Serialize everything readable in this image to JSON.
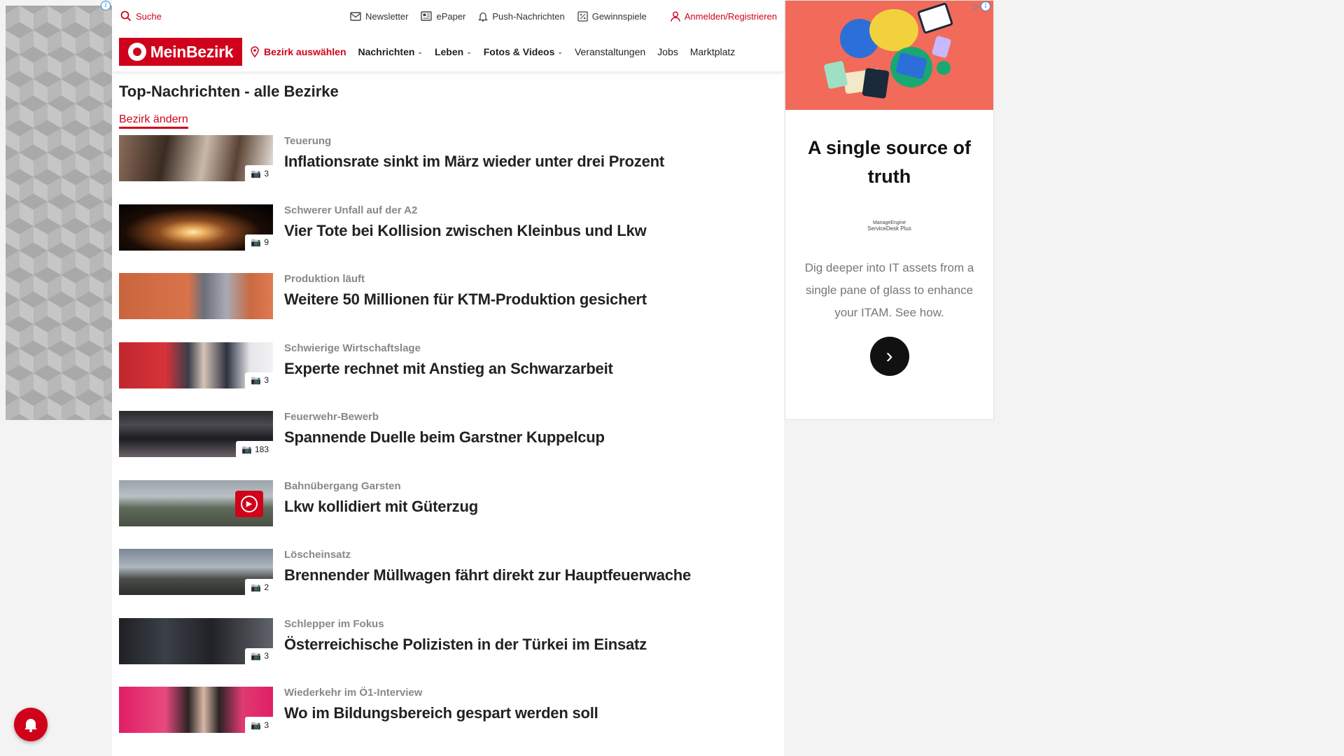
{
  "topbar": {
    "search": "Suche",
    "newsletter": "Newsletter",
    "epaper": "ePaper",
    "push": "Push-Nachrichten",
    "games": "Gewinnspiele",
    "login": "Anmelden/Registrieren"
  },
  "nav": {
    "logo": "MeinBezirk",
    "bezirk": "Bezirk auswählen",
    "items": [
      "Nachrichten",
      "Leben",
      "Fotos & Videos",
      "Veranstaltungen",
      "Jobs",
      "Marktplatz"
    ]
  },
  "page": {
    "title": "Top-Nachrichten - alle Bezirke",
    "change": "Bezirk ändern"
  },
  "articles": [
    {
      "kicker": "Teuerung",
      "headline": "Inflationsrate sinkt im März wieder unter drei Prozent",
      "badge": "3"
    },
    {
      "kicker": "Schwerer Unfall auf der A2",
      "headline": "Vier Tote bei Kollision zwischen Kleinbus und Lkw",
      "badge": "9"
    },
    {
      "kicker": "Produktion läuft",
      "headline": "Weitere 50 Millionen für KTM-Produktion gesichert",
      "badge": ""
    },
    {
      "kicker": "Schwierige Wirtschaftslage",
      "headline": "Experte rechnet mit Anstieg an Schwarzarbeit",
      "badge": "3"
    },
    {
      "kicker": "Feuerwehr-Bewerb",
      "headline": "Spannende Duelle beim Garstner Kuppelcup",
      "badge": "183"
    },
    {
      "kicker": "Bahnübergang Garsten",
      "headline": "Lkw kollidiert mit Güterzug",
      "badge": ""
    },
    {
      "kicker": "Löscheinsatz",
      "headline": "Brennender Müllwagen fährt direkt zur Hauptfeuerwache",
      "badge": "2"
    },
    {
      "kicker": "Schlepper im Fokus",
      "headline": "Österreichische Polizisten in der Türkei im Einsatz",
      "badge": "3"
    },
    {
      "kicker": "Wiederkehr im Ö1-Interview",
      "headline": "Wo im Bildungsbereich gespart werden soll",
      "badge": "3"
    }
  ],
  "ad": {
    "title": "A single source of truth",
    "brand_line1": "ManageEngine",
    "brand_line2": "ServiceDesk Plus",
    "description": "Dig deeper into IT assets from a single pane of glass to enhance your ITAM. See how.",
    "info": "i"
  },
  "colors": {
    "accent": "#d0021b",
    "ad_background": "#f26a5a"
  },
  "icons": [
    "search-icon",
    "mail-icon",
    "newspaper-icon",
    "bell-icon",
    "gift-icon",
    "user-icon",
    "location-pin-icon",
    "gallery-icon",
    "play-icon",
    "chevron-right-icon",
    "notification-bell-icon"
  ]
}
